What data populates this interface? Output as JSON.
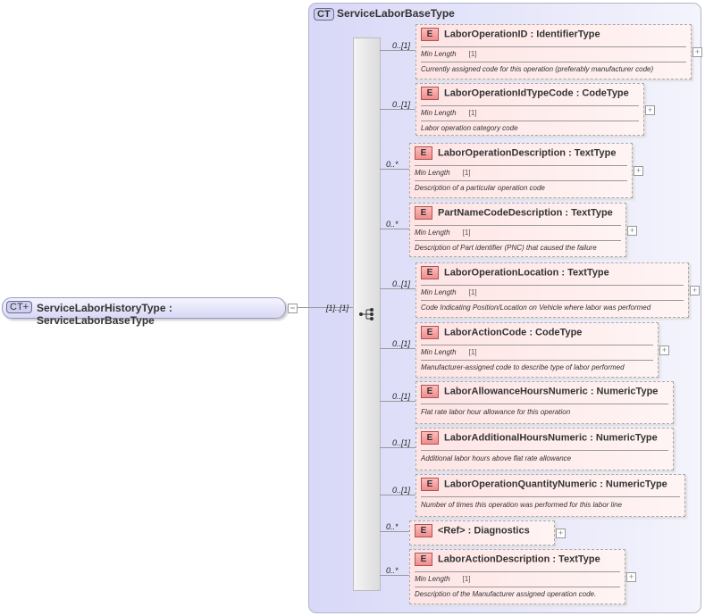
{
  "root": {
    "badge": "CT",
    "label": "ServiceLaborHistoryType : ServiceLaborBaseType",
    "cardinality": "[1]..[1]"
  },
  "complex_type": {
    "badge": "CT",
    "title": "ServiceLaborBaseType"
  },
  "elements": [
    {
      "badge": "E",
      "name": "LaborOperationID : IdentifierType",
      "card": "0..[1]",
      "min_label": "Min Length",
      "min_value": "[1]",
      "desc": "Currently assigned code for this operation (preferably manufacturer code)"
    },
    {
      "badge": "E",
      "name": "LaborOperationIdTypeCode : CodeType",
      "card": "0..[1]",
      "min_label": "Min Length",
      "min_value": "[1]",
      "desc": "Labor operation category code"
    },
    {
      "badge": "E",
      "name": "LaborOperationDescription : TextType",
      "card": "0..*",
      "min_label": "Min Length",
      "min_value": "[1]",
      "desc": "Description of a particular operation code"
    },
    {
      "badge": "E",
      "name": "PartNameCodeDescription : TextType",
      "card": "0..*",
      "min_label": "Min Length",
      "min_value": "[1]",
      "desc": "Description of Part identifier (PNC) that caused the failure"
    },
    {
      "badge": "E",
      "name": "LaborOperationLocation : TextType",
      "card": "0..[1]",
      "min_label": "Min Length",
      "min_value": "[1]",
      "desc": "Code Indicating Position/Location on Vehicle where labor was performed"
    },
    {
      "badge": "E",
      "name": "LaborActionCode : CodeType",
      "card": "0..[1]",
      "min_label": "Min Length",
      "min_value": "[1]",
      "desc": "Manufacturer-assigned code to describe type of labor performed"
    },
    {
      "badge": "E",
      "name": "LaborAllowanceHoursNumeric : NumericType",
      "card": "0..[1]",
      "desc": "Flat rate labor hour allowance for this operation"
    },
    {
      "badge": "E",
      "name": "LaborAdditionalHoursNumeric : NumericType",
      "card": "0..[1]",
      "desc": "Additional labor hours above flat rate allowance"
    },
    {
      "badge": "E",
      "name": "LaborOperationQuantityNumeric : NumericType",
      "card": "0..[1]",
      "desc": "Number of times this operation was performed for this labor line"
    },
    {
      "badge": "E",
      "name": "<Ref>     : Diagnostics",
      "card": "0..*"
    },
    {
      "badge": "E",
      "name": "LaborActionDescription : TextType",
      "card": "0..*",
      "min_label": "Min Length",
      "min_value": "[1]",
      "desc": "Description of the Manufacturer assigned operation code."
    }
  ]
}
